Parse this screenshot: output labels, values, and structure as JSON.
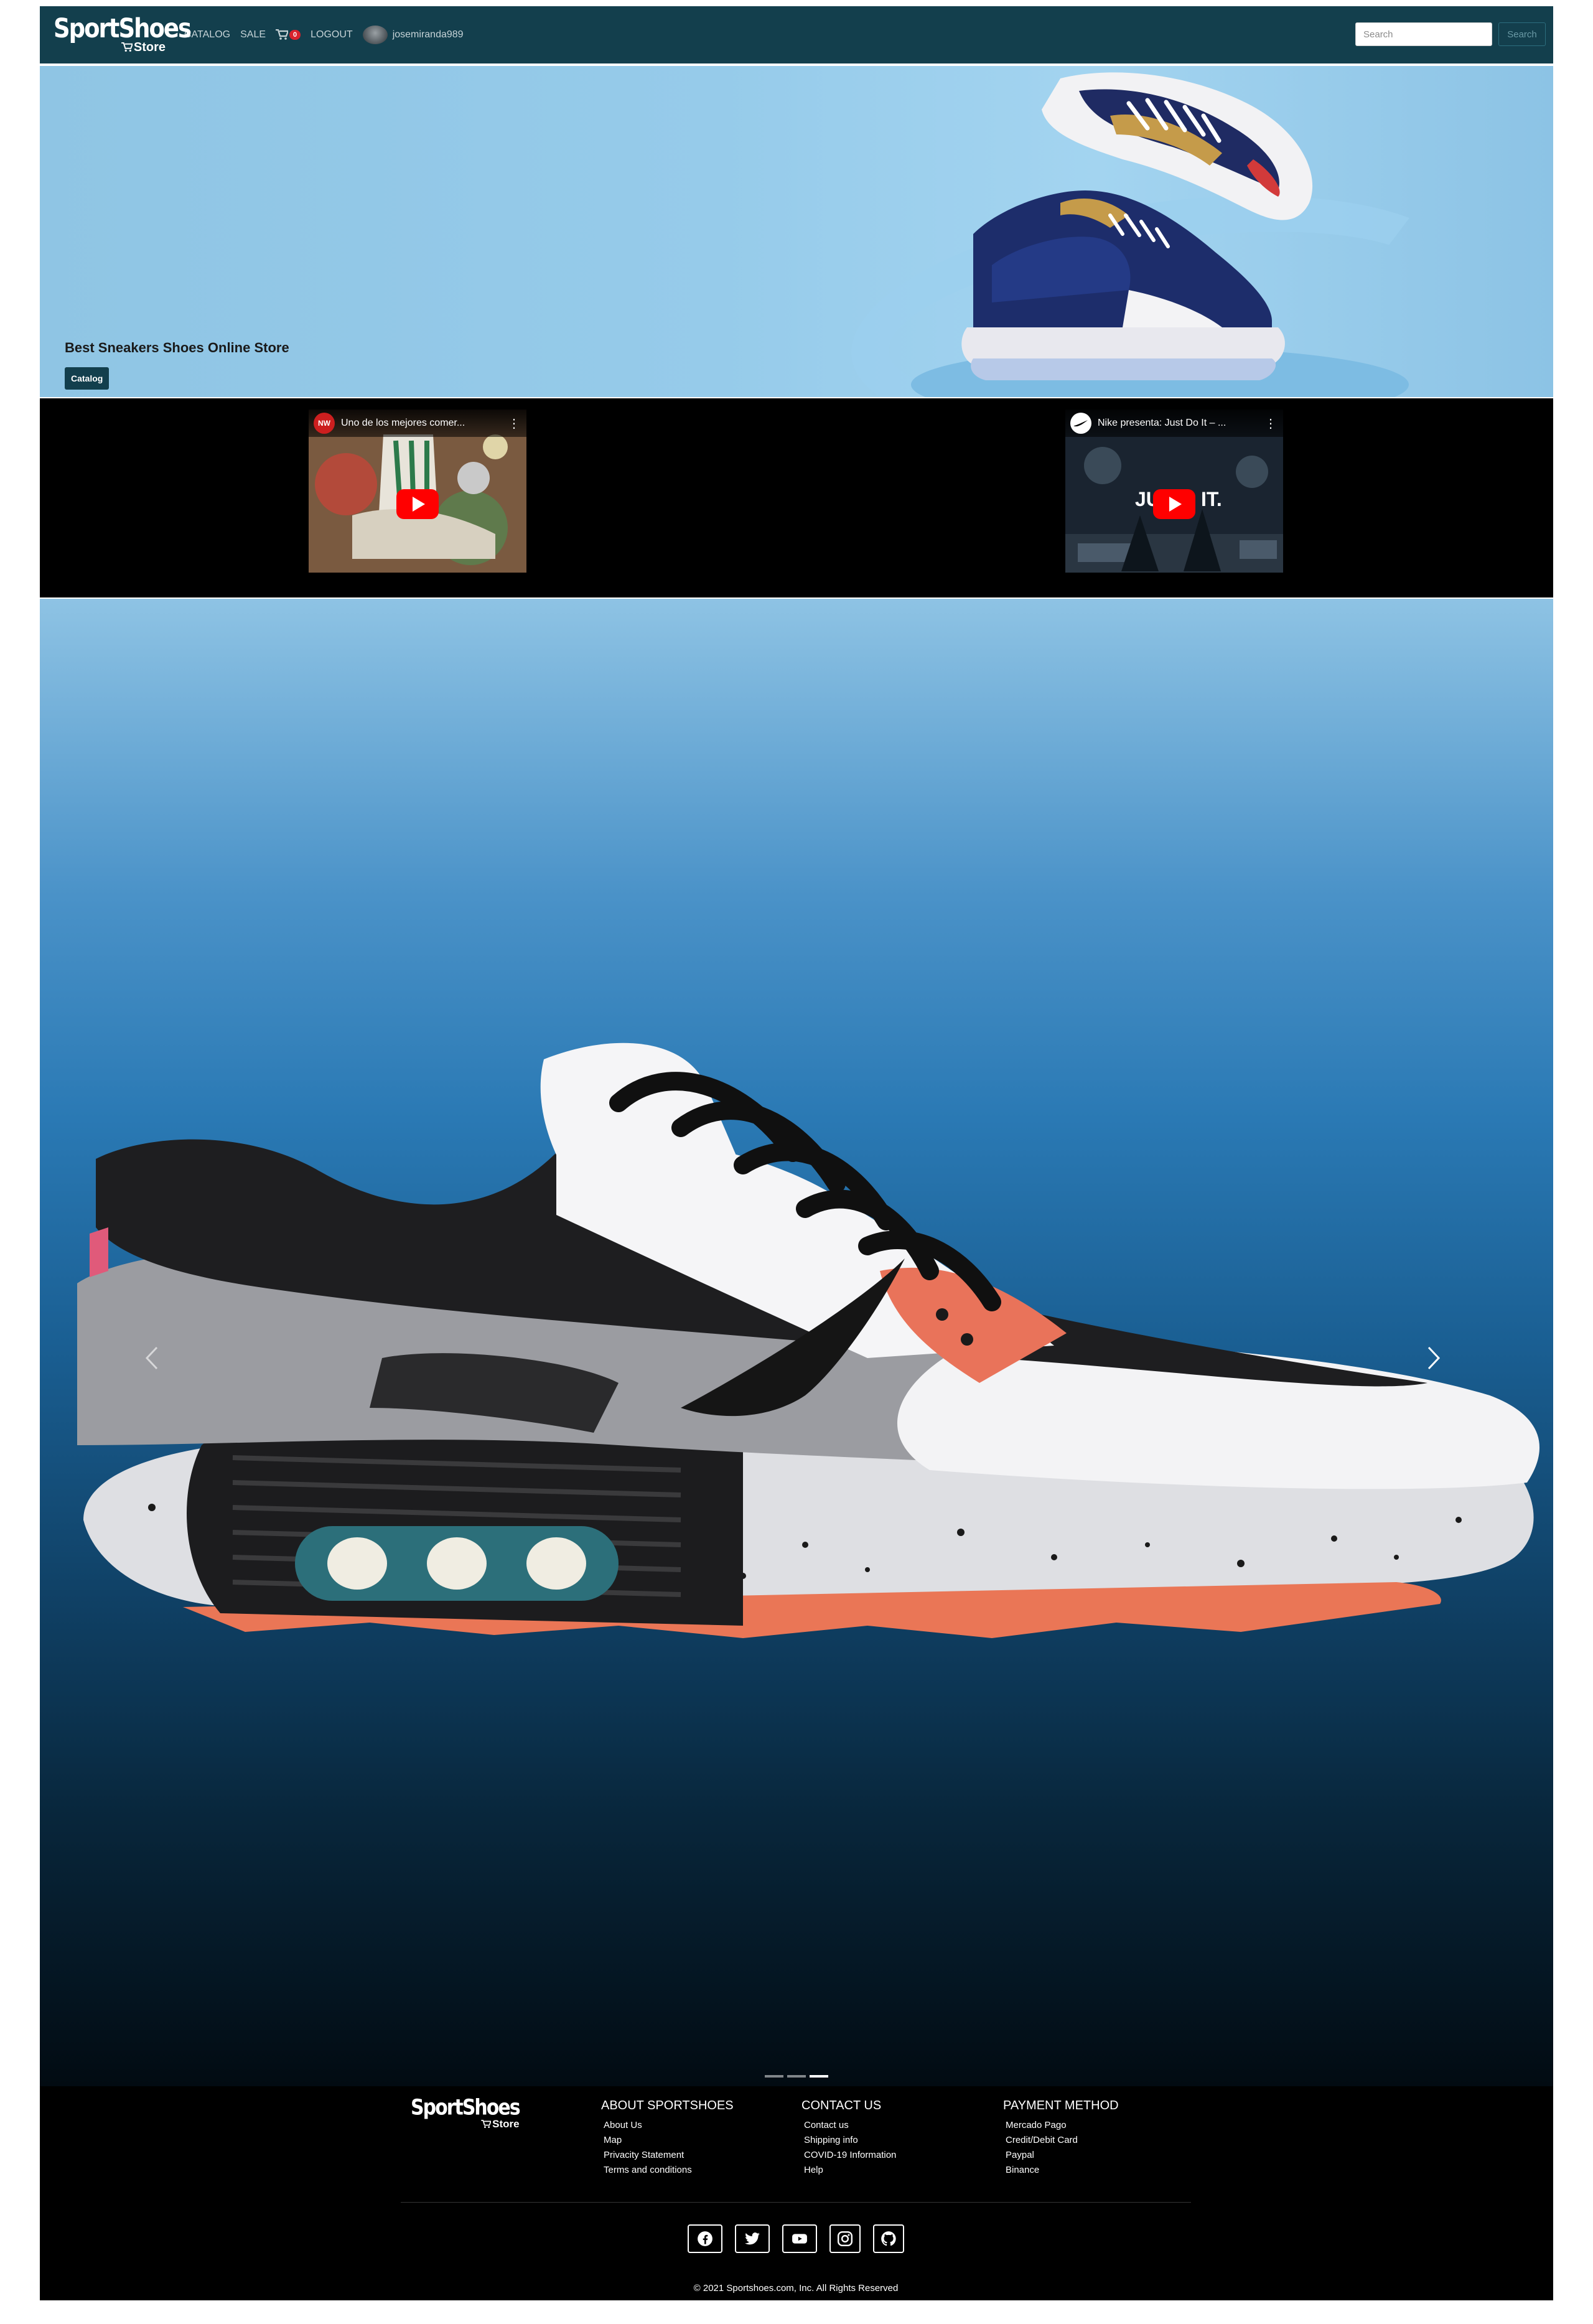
{
  "navbar": {
    "brand_main": "SportShoes",
    "brand_sub": "Store",
    "links": {
      "catalog": "CATALOG",
      "sale": "SALE",
      "logout": "LOGOUT"
    },
    "cart_count": "0",
    "username": "josemiranda989",
    "search_placeholder": "Search",
    "search_button": "Search"
  },
  "hero": {
    "title": "Best Sneakers Shoes Online Store",
    "button": "Catalog"
  },
  "videos": [
    {
      "title": "Uno de los mejores comer...",
      "channel_icon": "youtube-channel-icon"
    },
    {
      "title": "Nike presenta: Just Do It – ...",
      "channel_icon": "nike-channel-icon",
      "overlay_left": "JU",
      "overlay_right": "IT."
    }
  ],
  "carousel": {
    "slide_count": 3,
    "active_slide": 3
  },
  "footer": {
    "brand_main": "SportShoes",
    "brand_sub": "Store",
    "about": {
      "heading": "ABOUT SPORTSHOES",
      "items": [
        "About Us",
        "Map",
        "Privacity Statement",
        "Terms and conditions"
      ]
    },
    "contact": {
      "heading": "CONTACT US",
      "items": [
        "Contact us",
        "Shipping info",
        "COVID-19 Information",
        "Help"
      ]
    },
    "payment": {
      "heading": "PAYMENT METHOD",
      "items": [
        "Mercado Pago",
        "Credit/Debit Card",
        "Paypal",
        "Binance"
      ]
    },
    "social": [
      "facebook-icon",
      "twitter-icon",
      "youtube-icon",
      "instagram-icon",
      "github-icon"
    ],
    "copyright": "© 2021 Sportshoes.com, Inc. All Rights Reserved"
  },
  "colors": {
    "navbar": "#133f4d",
    "badge": "#d9232d",
    "youtube_red": "#ff0000"
  }
}
